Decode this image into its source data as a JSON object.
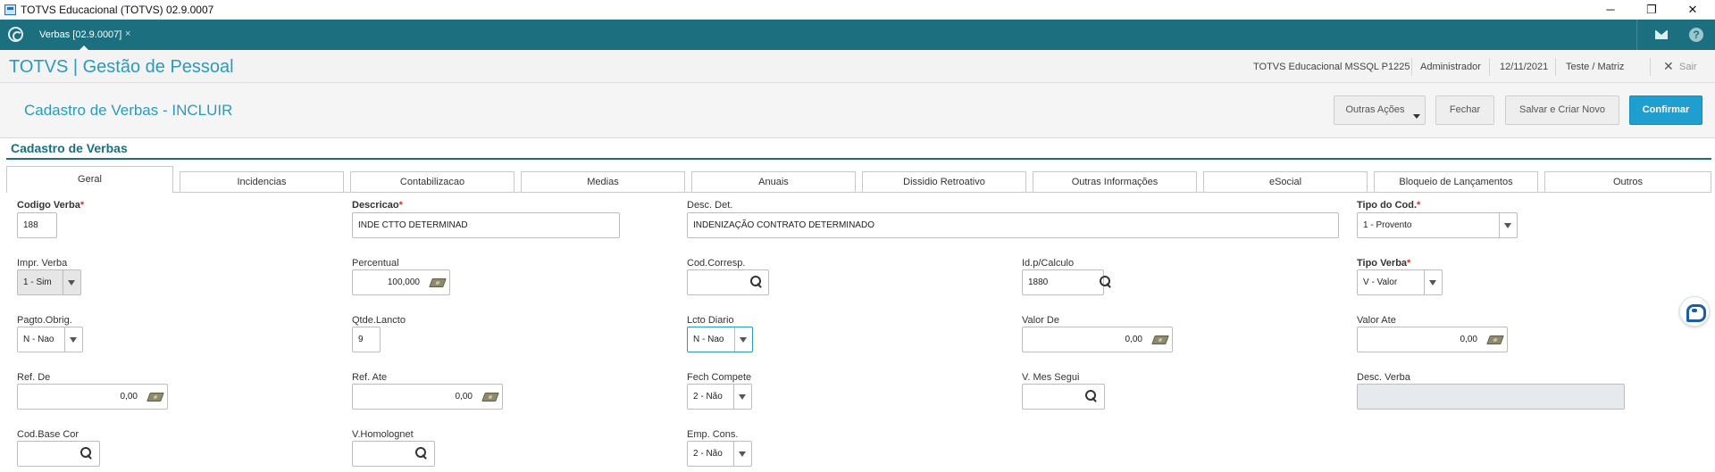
{
  "window": {
    "title": "TOTVS Educacional (TOTVS) 02.9.0007",
    "minimize": "─",
    "maximize": "❐",
    "close": "✕"
  },
  "tabs_bar": {
    "open_tab": "Verbas [02.9.0007]",
    "close_glyph": "×"
  },
  "header": {
    "brand": "TOTVS | Gestão de Pessoal",
    "environment": "TOTVS Educacional MSSQL P1225",
    "user": "Administrador",
    "date": "12/11/2021",
    "branch": "Teste / Matriz",
    "exit_glyph": "✕",
    "exit_label": "Sair"
  },
  "page": {
    "title": "Cadastro de Verbas - INCLUIR"
  },
  "actions": {
    "other": "Outras Ações",
    "close": "Fechar",
    "save_new": "Salvar e Criar Novo",
    "confirm": "Confirmar"
  },
  "section": {
    "title": "Cadastro de Verbas"
  },
  "form_tabs": [
    "Geral",
    "Incidencias",
    "Contabilizacao",
    "Medias",
    "Anuais",
    "Dissidio Retroativo",
    "Outras Informações",
    "eSocial",
    "Bloqueio de Lançamentos",
    "Outros"
  ],
  "fields": {
    "codigo_verba": {
      "label": "Codigo Verba",
      "required_mark": "*",
      "value": "188"
    },
    "descricao": {
      "label": "Descricao",
      "required_mark": "*",
      "value": "INDE CTTO DETERMINAD"
    },
    "desc_det": {
      "label": "Desc. Det.",
      "value": "INDENIZAÇÃO CONTRATO DETERMINADO"
    },
    "tipo_cod": {
      "label": "Tipo do Cod.",
      "required_mark": "*",
      "value": "1 - Provento"
    },
    "impr_verba": {
      "label": "Impr. Verba",
      "value": "1 - Sim"
    },
    "percentual": {
      "label": "Percentual",
      "value": "100,000"
    },
    "cod_corresp": {
      "label": "Cod.Corresp.",
      "value": ""
    },
    "id_calculo": {
      "label": "Id.p/Calculo",
      "value": "1880"
    },
    "tipo_verba": {
      "label": "Tipo Verba",
      "required_mark": "*",
      "value": "V - Valor"
    },
    "pagto_obrig": {
      "label": "Pagto.Obrig.",
      "value": "N - Nao"
    },
    "qtde_lancto": {
      "label": "Qtde.Lancto",
      "value": "9"
    },
    "lcto_diario": {
      "label": "Lcto Diario",
      "value": "N - Nao"
    },
    "valor_de": {
      "label": "Valor De",
      "value": "0,00"
    },
    "valor_ate": {
      "label": "Valor Ate",
      "value": "0,00"
    },
    "ref_de": {
      "label": "Ref. De",
      "value": "0,00"
    },
    "ref_ate": {
      "label": "Ref. Ate",
      "value": "0,00"
    },
    "fech_compete": {
      "label": "Fech Compete",
      "value": "2 - Não"
    },
    "v_mes_segui": {
      "label": "V. Mes Segui",
      "value": ""
    },
    "desc_verba": {
      "label": "Desc. Verba",
      "value": ""
    },
    "cod_base_cor": {
      "label": "Cod.Base Cor",
      "value": ""
    },
    "v_homolognet": {
      "label": "V.Homolognet",
      "value": ""
    },
    "emp_cons": {
      "label": "Emp. Cons.",
      "value": "2 - Não"
    }
  },
  "colors": {
    "brand": "#2a9bbd",
    "tabbar": "#1b6f7f",
    "primary_button": "#1e9fd0",
    "required": "#d93025"
  },
  "icons": [
    "app-icon",
    "home-icon",
    "mail-icon",
    "help-icon",
    "search-icon",
    "money-icon",
    "chevron-down-icon",
    "assistant-icon"
  ]
}
